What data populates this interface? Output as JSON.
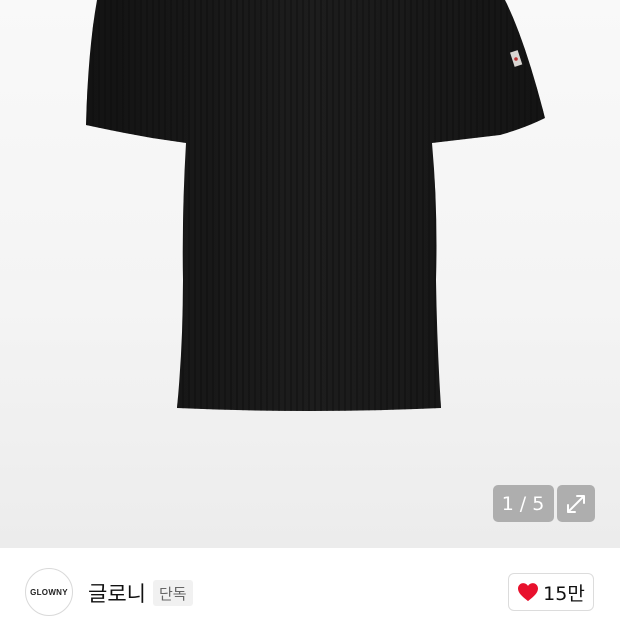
{
  "gallery": {
    "current_page": "1",
    "separator": "/",
    "total_pages": "5",
    "expand_icon": "expand-icon",
    "product_image": "black short-sleeve ribbed t-shirt"
  },
  "brand": {
    "logo_text": "GLOWNY",
    "name": "글로니",
    "badge": "단독"
  },
  "like": {
    "icon": "heart-icon",
    "count": "15만",
    "heart_color": "#e8112d"
  }
}
